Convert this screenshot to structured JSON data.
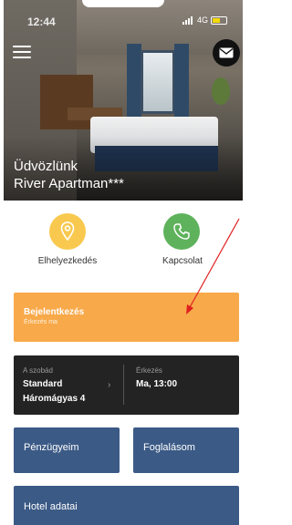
{
  "status_bar": {
    "time": "12:44",
    "network": "4G"
  },
  "hero": {
    "welcome": "Üdvözlünk",
    "apartment_name": "River Apartman***"
  },
  "actions": {
    "location_label": "Elhelyezkedés",
    "contact_label": "Kapcsolat"
  },
  "checkin": {
    "title": "Bejelentkezés",
    "subtitle": "Érkezés ma"
  },
  "room": {
    "caption": "A szobád",
    "type": "Standard",
    "name": "Háromágyas 4",
    "arrival_caption": "Érkezés",
    "arrival_value": "Ma, 13:00"
  },
  "buttons": {
    "finance": "Pénzügyeim",
    "booking": "Foglalásom",
    "hotel_info": "Hotel adatai"
  },
  "colors": {
    "checkin": "#f8a94a",
    "room_card": "#232323",
    "blue_buttons": "#3b5a86",
    "location": "#f8c94e",
    "contact": "#5fb25c",
    "annotation_arrow": "#e02020"
  },
  "icons": [
    "menu-icon",
    "mail-icon",
    "location-pin-icon",
    "phone-icon",
    "chevron-right-icon"
  ]
}
